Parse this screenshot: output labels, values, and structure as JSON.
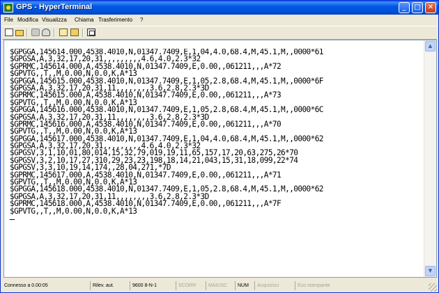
{
  "window": {
    "title": "GPS - HyperTerminal"
  },
  "title_buttons": {
    "minimize": "_",
    "maximize": "□",
    "close": "✕"
  },
  "menu": {
    "items": [
      "File",
      "Modifica",
      "Visualizza",
      "Chiama",
      "Trasferimento",
      "?"
    ]
  },
  "toolbar": {
    "icons": [
      "new-icon",
      "open-icon",
      "connect-icon",
      "disconnect-icon",
      "send-icon",
      "receive-icon",
      "properties-icon"
    ]
  },
  "terminal": {
    "lines": [
      "$GPGGA,145614.000,4538.4010,N,01347.7409,E,1,04,4.0,68.4,M,45.1,M,,0000*61",
      "$GPGSA,A,3,32,17,20,31,,,,,,,,,4.6,4.0,2.3*32",
      "$GPRMC,145614.000,A,4538.4010,N,01347.7409,E,0.00,,061211,,,A*72",
      "$GPVTG,,T,,M,0.00,N,0.0,K,A*13",
      "$GPGGA,145615.000,4538.4010,N,01347.7409,E,1,05,2.8,68.4,M,45.1,M,,0000*6F",
      "$GPGSA,A,3,32,17,20,31,11,,,,,,,,3.6,2.8,2.3*3D",
      "$GPRMC,145615.000,A,4538.4010,N,01347.7409,E,0.00,,061211,,,A*73",
      "$GPVTG,,T,,M,0.00,N,0.0,K,A*13",
      "$GPGGA,145616.000,4538.4010,N,01347.7409,E,1,05,2.8,68.4,M,45.1,M,,0000*6C",
      "$GPGSA,A,3,32,17,20,31,11,,,,,,,,3.6,2.8,2.3*3D",
      "$GPRMC,145616.000,A,4538.4010,N,01347.7409,E,0.00,,061211,,,A*70",
      "$GPVTG,,T,,M,0.00,N,0.0,K,A*13",
      "$GPGGA,145617.000,4538.4010,N,01347.7409,E,1,04,4.0,68.4,M,45.1,M,,0000*62",
      "$GPGSA,A,3,32,17,20,31,,,,,,,,,4.6,4.0,2.3*32",
      "$GPGSV,3,1,10,01,80,014,15,32,79,019,19,11,65,157,17,20,63,275,26*70",
      "$GPGSV,3,2,10,17,27,310,29,23,23,198,18,14,21,043,15,31,18,099,22*74",
      "$GPGSV,3,3,10,19,14,174,,28,04,271,*7D",
      "$GPRMC,145617.000,A,4538.4010,N,01347.7409,E,0.00,,061211,,,A*71",
      "$GPVTG,,T,,M,0.00,N,0.0,K,A*13",
      "$GPGGA,145618.000,4538.4010,N,01347.7409,E,1,05,2.8,68.4,M,45.1,M,,0000*62",
      "$GPGSA,A,3,32,17,20,31,11,,,,,,,,3.6,2.8,2.3*3D",
      "$GPRMC,145618.000,A,4538.4010,N,01347.7409,E,0.00,,061211,,,A*7F",
      "$GPVTG,,T,,M,0.00,N,0.0,K,A*13"
    ]
  },
  "scrollbar": {
    "up": "▲",
    "down": "▼"
  },
  "status": {
    "connected": "Connesso a 0.00:05",
    "detect": "Rilev. aut.",
    "settings": "9600 8-N-1",
    "scroll": "SCORR",
    "caps": "MAIUSC",
    "num": "NUM",
    "capture": "Acquisisci",
    "echo": "Eco stampante"
  },
  "colors": {
    "titlebar": "#0058e6",
    "chrome": "#ece9d8",
    "terminal_bg": "#ffffff",
    "terminal_text": "#000000"
  }
}
